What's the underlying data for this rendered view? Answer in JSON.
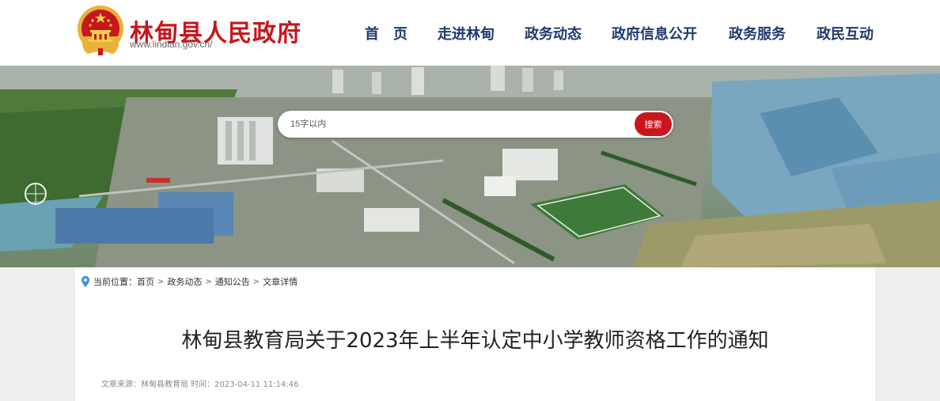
{
  "header": {
    "site_title": "林甸县人民政府",
    "site_url": "www.lindian.gov.cn/",
    "emblem_icon": "national-emblem-icon",
    "brand_color": "#c8161d",
    "nav_color": "#1f3a6e"
  },
  "nav": {
    "items": [
      {
        "label": "首　页"
      },
      {
        "label": "走进林甸"
      },
      {
        "label": "政务动态"
      },
      {
        "label": "政府信息公开"
      },
      {
        "label": "政务服务"
      },
      {
        "label": "政民互动"
      }
    ]
  },
  "search": {
    "placeholder": "15字以内",
    "button_label": "搜索"
  },
  "breadcrumb": {
    "prefix": "当前位置：",
    "items": [
      "首页",
      "政务动态",
      "通知公告",
      "文章详情"
    ],
    "separator": ">",
    "icon": "location-pin-icon"
  },
  "article": {
    "title": "林甸县教育局关于2023年上半年认定中小学教师资格工作的通知",
    "meta": "文章来源：林甸县教育局 时间：2023-04-11 11:14:46"
  }
}
